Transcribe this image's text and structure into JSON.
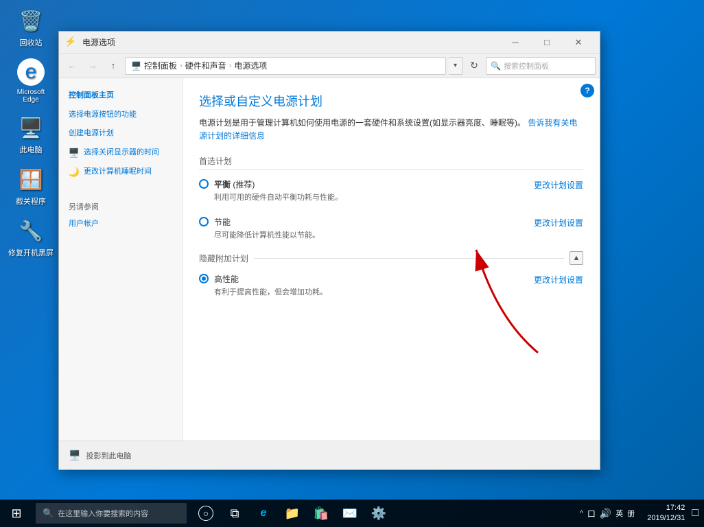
{
  "desktop": {
    "icons": [
      {
        "id": "recycle-bin",
        "label": "回收站",
        "icon": "🗑️"
      },
      {
        "id": "edge",
        "label": "Microsoft Edge",
        "icon": "🌐"
      },
      {
        "id": "my-computer",
        "label": "此电脑",
        "icon": "🖥️"
      },
      {
        "id": "programs",
        "label": "截关程序",
        "icon": "🪟"
      },
      {
        "id": "repair",
        "label": "修复开机黑屏",
        "icon": "🔧"
      }
    ]
  },
  "window": {
    "title": "电源选项",
    "icon": "⚡",
    "address_back": "←",
    "address_forward": "→",
    "address_up": "↑",
    "address_path": [
      {
        "text": "控制面板"
      },
      {
        "text": "硬件和声音"
      },
      {
        "text": "电源选项"
      }
    ],
    "address_search_placeholder": "搜索控制面板",
    "sidebar": {
      "title": "控制面板主页",
      "items": [
        {
          "id": "choose-power",
          "label": "选择电源按钮的功能",
          "has_icon": false
        },
        {
          "id": "create-plan",
          "label": "创建电源计划",
          "has_icon": false
        },
        {
          "id": "choose-display",
          "label": "选择关闭显示器的时间",
          "has_icon": true,
          "icon_type": "monitor"
        },
        {
          "id": "sleep-time",
          "label": "更改计算机睡眠时间",
          "has_icon": true,
          "icon_type": "moon"
        }
      ],
      "see_also_title": "另请参阅",
      "see_also_items": [
        {
          "id": "user-account",
          "label": "用户帐户"
        }
      ]
    },
    "main": {
      "title": "选择或自定义电源计划",
      "description": "电源计划是用于管理计算机如何使用电源的一套硬件和系统设置(如显示器亮度、睡眠等)。",
      "link_text": "告诉我有关电源计划的详细信息",
      "preferred_section": "首选计划",
      "plans": [
        {
          "id": "balanced",
          "name": "平衡 (推荐)",
          "name_bold": "平衡",
          "name_suffix": " (推荐)",
          "description": "利用可用的硬件自动平衡功耗与性能。",
          "change_label": "更改计划设置",
          "selected": false
        },
        {
          "id": "power-save",
          "name": "节能",
          "description": "尽可能降低计算机性能以节能。",
          "change_label": "更改计划设置",
          "selected": false
        }
      ],
      "hidden_section_title": "隐藏附加计划",
      "hidden_plans": [
        {
          "id": "high-perf",
          "name": "高性能",
          "description": "有利于提高性能，但会增加功耗。",
          "change_label": "更改计划设置",
          "selected": true
        }
      ]
    },
    "footer": {
      "icon": "🖥️",
      "text": "投影到此电脑"
    }
  },
  "taskbar": {
    "start_icon": "⊞",
    "search_placeholder": "在这里输入你要搜索的内容",
    "apps": [
      {
        "id": "cortana",
        "icon": "○"
      },
      {
        "id": "task-view",
        "icon": "⧉"
      },
      {
        "id": "edge",
        "icon": "e"
      },
      {
        "id": "explorer",
        "icon": "📁"
      },
      {
        "id": "store",
        "icon": "🛍️"
      },
      {
        "id": "mail",
        "icon": "✉️"
      },
      {
        "id": "settings",
        "icon": "⚙️"
      }
    ],
    "tray": {
      "show_hidden": "^",
      "keyboard": "口",
      "volume": "🔊",
      "language": "英",
      "ime": "册"
    },
    "clock": {
      "time": "17:42",
      "date": "2019/12/31"
    },
    "notification": "□"
  }
}
